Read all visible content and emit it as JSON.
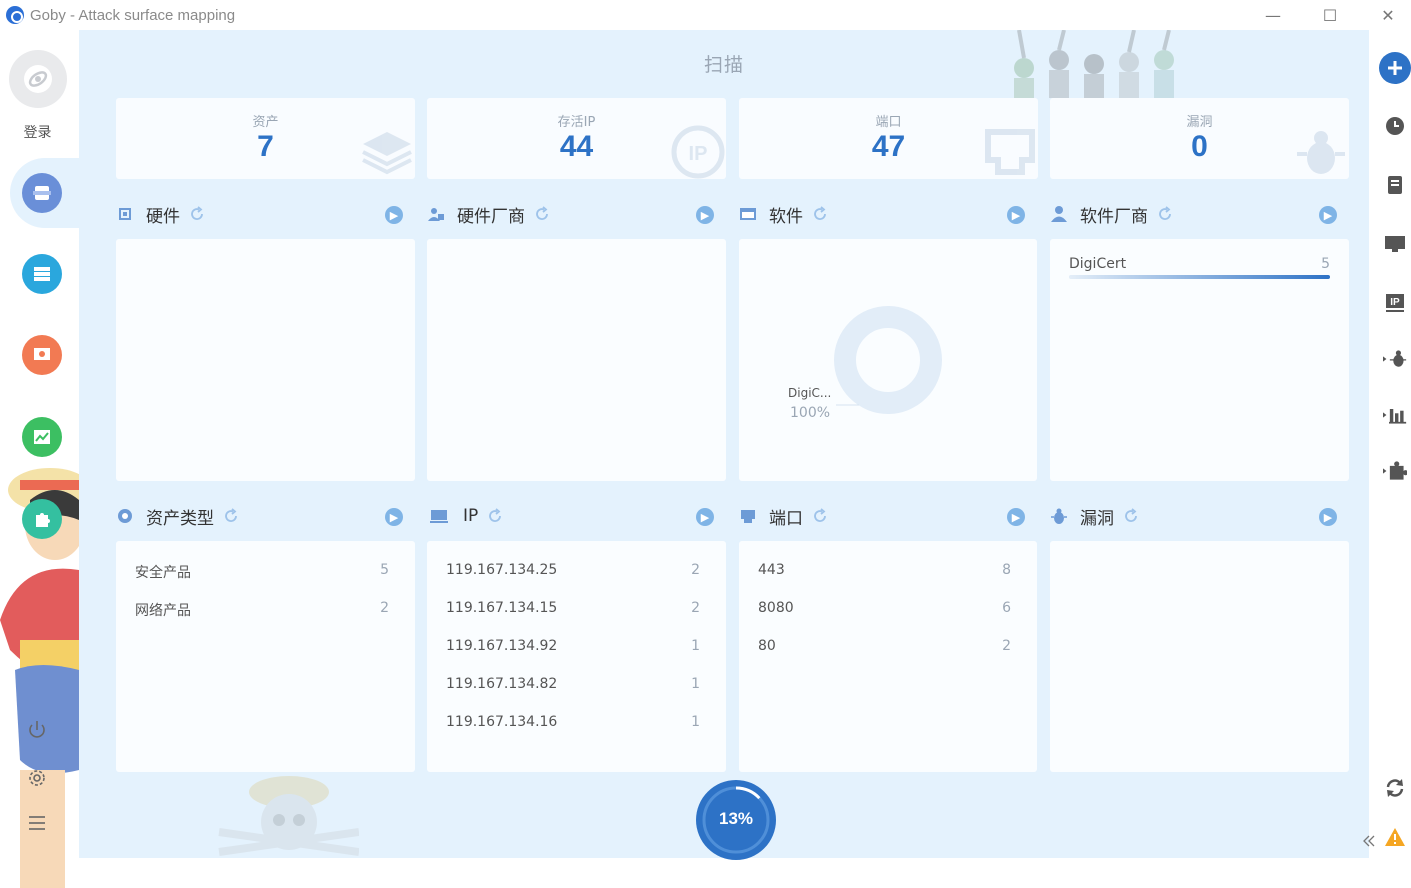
{
  "window": {
    "title": "Goby - Attack surface mapping",
    "minimize_glyph": "—",
    "maximize_glyph": "☐",
    "close_glyph": "✕"
  },
  "sidebar": {
    "login_label": "登录",
    "nav_items": [
      {
        "name": "scan",
        "icon": "scan-icon",
        "color": "#6a8fd8"
      },
      {
        "name": "assets",
        "icon": "list-icon",
        "color": "#2aa7dd"
      },
      {
        "name": "vulnerabilities",
        "icon": "bug-icon",
        "color": "#f27a53"
      },
      {
        "name": "reports",
        "icon": "chart-icon",
        "color": "#3cbf62"
      },
      {
        "name": "extensions",
        "icon": "puzzle-icon",
        "color": "#34c0a0"
      }
    ],
    "bottom_icons": [
      "power-icon",
      "gear-icon",
      "menu-icon"
    ]
  },
  "main": {
    "heading": "扫描",
    "stats": [
      {
        "label": "资产",
        "value": "7",
        "icon": "layers-icon"
      },
      {
        "label": "存活IP",
        "value": "44",
        "icon": "ip-icon"
      },
      {
        "label": "端口",
        "value": "47",
        "icon": "port-icon"
      },
      {
        "label": "漏洞",
        "value": "0",
        "icon": "bug-icon"
      }
    ],
    "sections_top": [
      {
        "title": "硬件",
        "icon": "chip-icon"
      },
      {
        "title": "硬件厂商",
        "icon": "vendor-icon"
      },
      {
        "title": "软件",
        "icon": "software-icon"
      },
      {
        "title": "软件厂商",
        "icon": "user-icon"
      }
    ],
    "sections_bottom": [
      {
        "title": "资产类型",
        "icon": "asset-type-icon"
      },
      {
        "title": "IP",
        "icon": "monitor-icon"
      },
      {
        "title": "端口",
        "icon": "port-icon"
      },
      {
        "title": "漏洞",
        "icon": "bug-icon"
      }
    ],
    "software_donut": {
      "label": "DigiC...",
      "percent": "100%",
      "fraction": 1.0
    },
    "software_vendor_bar": {
      "name": "DigiCert",
      "count": "5",
      "fraction": 1.0
    },
    "asset_types": [
      {
        "name": "安全产品",
        "count": "5"
      },
      {
        "name": "网络产品",
        "count": "2"
      }
    ],
    "ips": [
      {
        "name": "119.167.134.25",
        "count": "2"
      },
      {
        "name": "119.167.134.15",
        "count": "2"
      },
      {
        "name": "119.167.134.92",
        "count": "1"
      },
      {
        "name": "119.167.134.82",
        "count": "1"
      },
      {
        "name": "119.167.134.16",
        "count": "1"
      }
    ],
    "ports": [
      {
        "name": "443",
        "count": "8"
      },
      {
        "name": "8080",
        "count": "6"
      },
      {
        "name": "80",
        "count": "2"
      }
    ],
    "progress": {
      "label": "13%",
      "fraction": 0.13
    }
  },
  "rightbar": {
    "icons": [
      "add-icon",
      "clock-icon",
      "document-icon",
      "monitor-icon",
      "ip-icon",
      "bug-icon",
      "bar-chart-icon",
      "puzzle-icon",
      "refresh-icon",
      "warning-icon",
      "collapse-icon"
    ]
  },
  "colors": {
    "accent": "#2d72c6",
    "panel_bg": "#e4f2fd",
    "muted_text": "#9aa6b4"
  }
}
